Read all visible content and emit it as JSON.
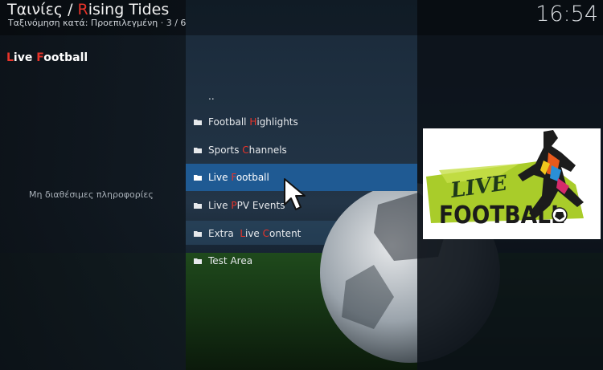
{
  "header": {
    "title_prefix": "Ταινίες / ",
    "title_initial": "R",
    "title_rest": "ising Tides",
    "subtitle": "Ταξινόμηση κατά: Προεπιλεγμένη  ·  3 / 6",
    "clock": "16:54"
  },
  "left_panel": {
    "title_l": "L",
    "title_a": "ive ",
    "title_f": "F",
    "title_b": "ootball",
    "no_info": "Μη διαθέσιμες πληροφορίες"
  },
  "list": {
    "parent": "..",
    "items": [
      {
        "pre": "Football ",
        "hl": "H",
        "post": "ighlights",
        "selected": false
      },
      {
        "pre": "Sports ",
        "hl": "C",
        "post": "hannels",
        "selected": false
      },
      {
        "pre": "Live ",
        "hl": "F",
        "post": "ootball",
        "selected": true
      },
      {
        "pre": "Live ",
        "hl": "P",
        "post": "PV Events",
        "selected": false
      },
      {
        "pre": "Extra  ",
        "hl": "L",
        "post": "ive ",
        "hl2": "C",
        "post2": "ontent",
        "selected": false
      },
      {
        "pre": "Test Area",
        "hl": "",
        "post": "",
        "selected": false
      }
    ]
  },
  "thumbnail": {
    "word1": "LIVE",
    "word2": "FOOTBALL"
  },
  "colors": {
    "accent": "#e8342a",
    "selection": "#1f5a93",
    "panel": "#0e151d"
  },
  "icons": {
    "folder": "folder-icon",
    "cursor": "mouse-pointer-icon"
  }
}
